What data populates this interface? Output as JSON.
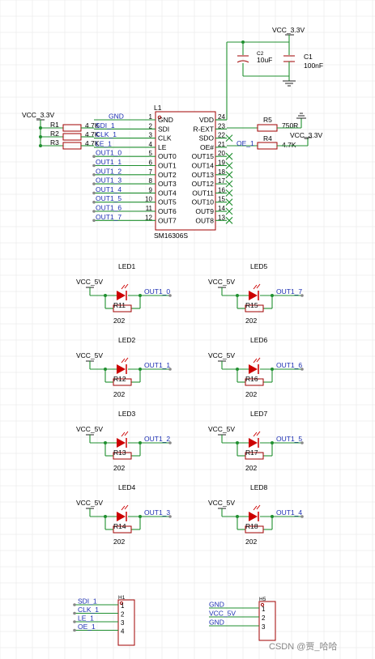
{
  "chip": {
    "designator": "L1",
    "part": "SM16306S",
    "left_pins": [
      {
        "num": "1",
        "name": "GND",
        "net": "GND"
      },
      {
        "num": "2",
        "name": "SDI",
        "net": "SDI_1"
      },
      {
        "num": "3",
        "name": "CLK",
        "net": "CLK_1"
      },
      {
        "num": "4",
        "name": "LE",
        "net": "LE_1"
      },
      {
        "num": "5",
        "name": "OUT0",
        "net": "OUT1_0"
      },
      {
        "num": "6",
        "name": "OUT1",
        "net": "OUT1_1"
      },
      {
        "num": "7",
        "name": "OUT2",
        "net": "OUT1_2"
      },
      {
        "num": "8",
        "name": "OUT3",
        "net": "OUT1_3"
      },
      {
        "num": "9",
        "name": "OUT4",
        "net": "OUT1_4"
      },
      {
        "num": "10",
        "name": "OUT5",
        "net": "OUT1_5"
      },
      {
        "num": "11",
        "name": "OUT6",
        "net": "OUT1_6"
      },
      {
        "num": "12",
        "name": "OUT7",
        "net": "OUT1_7"
      }
    ],
    "right_pins": [
      {
        "num": "24",
        "name": "VDD"
      },
      {
        "num": "23",
        "name": "R-EXT"
      },
      {
        "num": "22",
        "name": "SDO"
      },
      {
        "num": "21",
        "name": "OE#"
      },
      {
        "num": "20",
        "name": "OUT15"
      },
      {
        "num": "19",
        "name": "OUT14"
      },
      {
        "num": "18",
        "name": "OUT13"
      },
      {
        "num": "17",
        "name": "OUT12"
      },
      {
        "num": "16",
        "name": "OUT11"
      },
      {
        "num": "15",
        "name": "OUT10"
      },
      {
        "num": "14",
        "name": "OUT9"
      },
      {
        "num": "13",
        "name": "OUT8"
      }
    ]
  },
  "power": {
    "vcc_top": "VCC_3.3V",
    "vcc_left": "VCC_3.3V",
    "vcc_right": "VCC_3.3V"
  },
  "caps": [
    {
      "ref": "C2",
      "value": "10uF"
    },
    {
      "ref": "C1",
      "value": "100nF"
    }
  ],
  "pullups": [
    {
      "ref": "R1",
      "value": "4.7K"
    },
    {
      "ref": "R2",
      "value": "4.7K"
    },
    {
      "ref": "R3",
      "value": "4.7K"
    }
  ],
  "r5": {
    "ref": "R5",
    "value": "750R"
  },
  "r4": {
    "ref": "R4",
    "value": "4.7K",
    "net": "OE_1"
  },
  "leds": [
    {
      "led": "LED1",
      "vcc": "VCC_5V",
      "net": "OUT1_0",
      "res": "R11",
      "val": "202"
    },
    {
      "led": "LED2",
      "vcc": "VCC_5V",
      "net": "OUT1_1",
      "res": "R12",
      "val": "202"
    },
    {
      "led": "LED3",
      "vcc": "VCC_5V",
      "net": "OUT1_2",
      "res": "R13",
      "val": "202"
    },
    {
      "led": "LED4",
      "vcc": "VCC_5V",
      "net": "OUT1_3",
      "res": "R14",
      "val": "202"
    },
    {
      "led": "LED5",
      "vcc": "VCC_5V",
      "net": "OUT1_7",
      "res": "R15",
      "val": "202"
    },
    {
      "led": "LED6",
      "vcc": "VCC_5V",
      "net": "OUT1_6",
      "res": "R16",
      "val": "202"
    },
    {
      "led": "LED7",
      "vcc": "VCC_5V",
      "net": "OUT1_5",
      "res": "R17",
      "val": "202"
    },
    {
      "led": "LED8",
      "vcc": "VCC_5V",
      "net": "OUT1_4",
      "res": "R18",
      "val": "202"
    }
  ],
  "h1": {
    "ref": "H1",
    "pins": [
      "1",
      "2",
      "3",
      "4"
    ],
    "nets": [
      "SDI_1",
      "CLK_1",
      "LE_1",
      "OE_1"
    ]
  },
  "h5": {
    "ref": "H5",
    "pins": [
      "1",
      "2",
      "3"
    ],
    "nets": [
      "GND",
      "VCC_5V",
      "GND"
    ]
  },
  "watermark": "CSDN @贾_哈哈"
}
